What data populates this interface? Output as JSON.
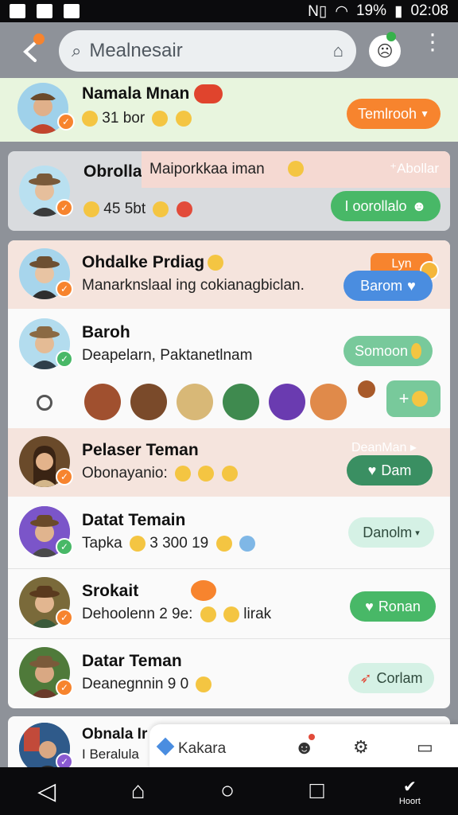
{
  "colors": {
    "orange": "#f7842e",
    "green": "#48b867",
    "dark_green": "#3a8f62",
    "blue": "#4a8de0",
    "mint": "#d5f1e5",
    "highlight_top": "#e8f5de",
    "highlight_pink": "#f5e4dd"
  },
  "status_bar": {
    "battery": "19%",
    "time": "02:08"
  },
  "top_bar": {
    "search_text": "Mealnesair"
  },
  "threads": [
    {
      "name": "Namala Mnan",
      "snippet": "31 bor",
      "action": "Temlrooh",
      "action_icon": "chevron-down-icon"
    },
    {
      "name": "Obrolla",
      "tag": "Maiporkkaa iman",
      "snippet": "45 5bt",
      "top_right": "Abollar",
      "action": "I oorollalo"
    },
    {
      "name": "Ohdalke Prdiag",
      "snippet": "Manarknslaal ing cokianagbiclan.",
      "badge": "Lyn",
      "action": "Barom"
    },
    {
      "name": "Baroh",
      "snippet": "Deapelarn, Paktanetlnam",
      "action": "Somoon"
    },
    {
      "name": "Pelaser Teman",
      "snippet": "Obonayanio:",
      "top_right": "DeanMan",
      "action": "Dam"
    },
    {
      "name": "Datat Temain",
      "snippet": "Tapka",
      "snippet_num": "3 300 19",
      "action": "Danolm"
    },
    {
      "name": "Srokait",
      "snippet": "Dehoolenn 2 9e:",
      "snippet_tail": "lirak",
      "action": "Ronan"
    },
    {
      "name": "Datar Teman",
      "snippet": "Deanegnnin 9 0",
      "action": "Corlam"
    },
    {
      "name": "Obnala Ir",
      "snippet": "I Beralula"
    }
  ],
  "floating_bar": {
    "label": "Kakara"
  },
  "bottom_nav": {
    "last_label": "Hoort"
  }
}
